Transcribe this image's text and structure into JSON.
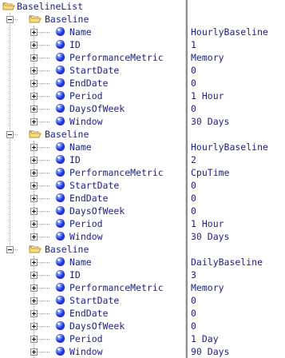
{
  "root": {
    "label": "BaselineList"
  },
  "baselines": [
    {
      "label": "Baseline",
      "properties": [
        {
          "name": "Name",
          "value": "HourlyBaseline"
        },
        {
          "name": "ID",
          "value": "1"
        },
        {
          "name": "PerformanceMetric",
          "value": "Memory"
        },
        {
          "name": "StartDate",
          "value": "0"
        },
        {
          "name": "EndDate",
          "value": "0"
        },
        {
          "name": "Period",
          "value": "1 Hour"
        },
        {
          "name": "DaysOfWeek",
          "value": "0"
        },
        {
          "name": "Window",
          "value": "30 Days"
        }
      ]
    },
    {
      "label": "Baseline",
      "properties": [
        {
          "name": "Name",
          "value": "HourlyBaseline"
        },
        {
          "name": "ID",
          "value": "2"
        },
        {
          "name": "PerformanceMetric",
          "value": "CpuTime"
        },
        {
          "name": "StartDate",
          "value": "0"
        },
        {
          "name": "EndDate",
          "value": "0"
        },
        {
          "name": "DaysOfWeek",
          "value": "0"
        },
        {
          "name": "Period",
          "value": "1 Hour"
        },
        {
          "name": "Window",
          "value": "30 Days"
        }
      ]
    },
    {
      "label": "Baseline",
      "properties": [
        {
          "name": "Name",
          "value": "DailyBaseline"
        },
        {
          "name": "ID",
          "value": "3"
        },
        {
          "name": "PerformanceMetric",
          "value": "Memory"
        },
        {
          "name": "StartDate",
          "value": "0"
        },
        {
          "name": "EndDate",
          "value": "0"
        },
        {
          "name": "DaysOfWeek",
          "value": "0"
        },
        {
          "name": "Period",
          "value": "1 Day"
        },
        {
          "name": "Window",
          "value": "90 Days"
        }
      ]
    }
  ],
  "icons": {
    "folder": "open-folder-icon",
    "property": "property-orb-icon",
    "expand": "plus-expander-icon",
    "collapse": "minus-expander-icon"
  },
  "colors": {
    "text": "#1d1f86",
    "background": "#ffffff",
    "guide": "#a0a0a0",
    "divider": "#8f8f8f",
    "folder": "#e7c865",
    "orb": "#2035d9"
  }
}
